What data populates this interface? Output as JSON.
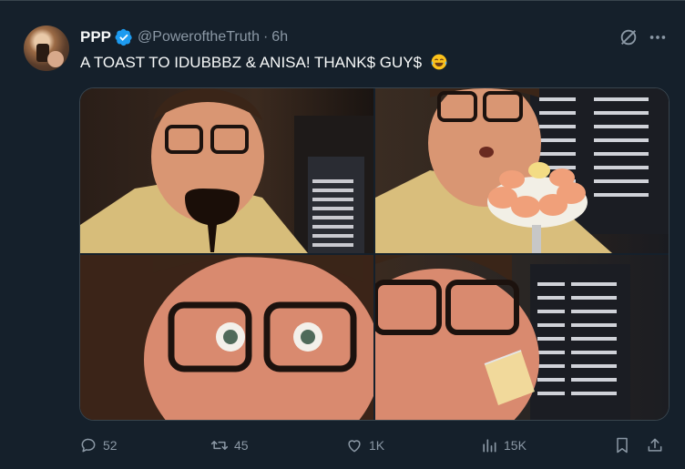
{
  "tweet": {
    "author_name": "PPP",
    "handle": "@PoweroftheTruth",
    "separator": "·",
    "time": "6h",
    "text": "A TOAST TO IDUBBBZ & ANISA! THANK$ GUY$",
    "emoji": "face-with-tears-of-joy"
  },
  "icons": {
    "verified": "verified-badge-icon",
    "grok": "grok-icon",
    "more": "more-icon",
    "reply": "reply-icon",
    "retweet": "retweet-icon",
    "like": "heart-icon",
    "views": "views-icon",
    "bookmark": "bookmark-icon",
    "share": "share-icon"
  },
  "actions": {
    "replies": "52",
    "retweets": "45",
    "likes": "1K",
    "views": "15K"
  },
  "colors": {
    "background": "#15202b",
    "muted": "#8b98a5",
    "verified": "#1d9bf0",
    "border": "#38444d"
  }
}
